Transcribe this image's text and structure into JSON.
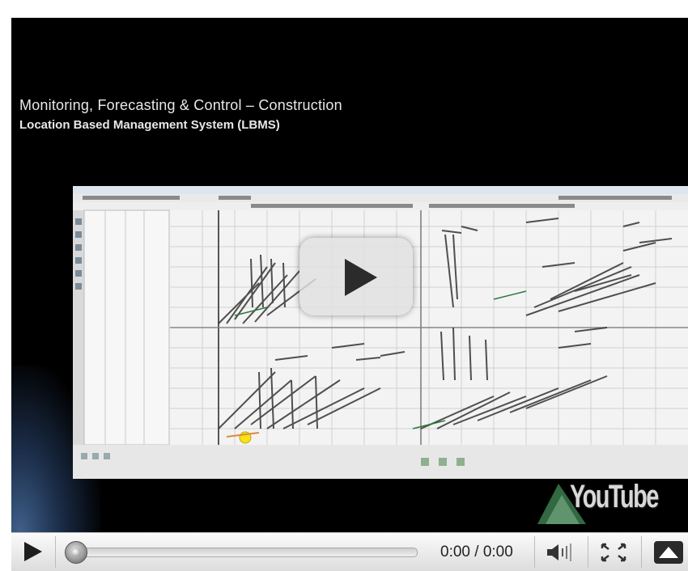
{
  "video": {
    "title_line1": "Monitoring, Forecasting & Control – Construction",
    "title_line2": "Location Based Management System (LBMS)",
    "logo_text": "YouTube"
  },
  "controls": {
    "time_display": "0:00 / 0:00",
    "progress": 0
  },
  "icons": {
    "play": "play-icon",
    "overlay_play": "big-play-icon",
    "volume": "volume-icon",
    "fullscreen": "fullscreen-icon",
    "menu": "menu-up-icon"
  },
  "colors": {
    "video_bg": "#000000",
    "title_text": "#e8e8e8",
    "controls_bg": "#e6e6e6"
  }
}
